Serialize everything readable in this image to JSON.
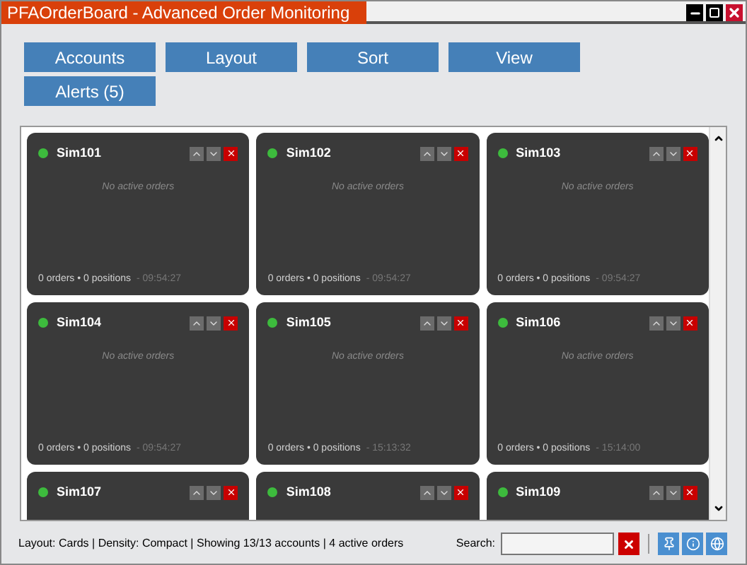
{
  "window": {
    "title": "PFAOrderBoard - Advanced Order Monitoring"
  },
  "toolbar": [
    {
      "label": "Accounts"
    },
    {
      "label": "Layout"
    },
    {
      "label": "Sort"
    },
    {
      "label": "View"
    },
    {
      "label": "Alerts (5)"
    }
  ],
  "cards": [
    {
      "name": "Sim101",
      "color": "#3dbb3d",
      "empty": "No active orders",
      "summary": "0 orders • 0 positions",
      "time": "- 09:54:27"
    },
    {
      "name": "Sim102",
      "color": "#3dbb3d",
      "empty": "No active orders",
      "summary": "0 orders • 0 positions",
      "time": "- 09:54:27"
    },
    {
      "name": "Sim103",
      "color": "#3dbb3d",
      "empty": "No active orders",
      "summary": "0 orders • 0 positions",
      "time": "- 09:54:27"
    },
    {
      "name": "Sim104",
      "color": "#3dbb3d",
      "empty": "No active orders",
      "summary": "0 orders • 0 positions",
      "time": "- 09:54:27"
    },
    {
      "name": "Sim105",
      "color": "#3dbb3d",
      "empty": "No active orders",
      "summary": "0 orders • 0 positions",
      "time": "- 15:13:32"
    },
    {
      "name": "Sim106",
      "color": "#3dbb3d",
      "empty": "No active orders",
      "summary": "0 orders • 0 positions",
      "time": "- 15:14:00"
    },
    {
      "name": "Sim107",
      "color": "#3dbb3d"
    },
    {
      "name": "Sim108",
      "color": "#3dbb3d"
    },
    {
      "name": "Sim109",
      "color": "#3dbb3d"
    }
  ],
  "status_bar": {
    "text": "Layout: Cards | Density: Compact | Showing 13/13 accounts | 4 active orders",
    "search_label": "Search:"
  }
}
